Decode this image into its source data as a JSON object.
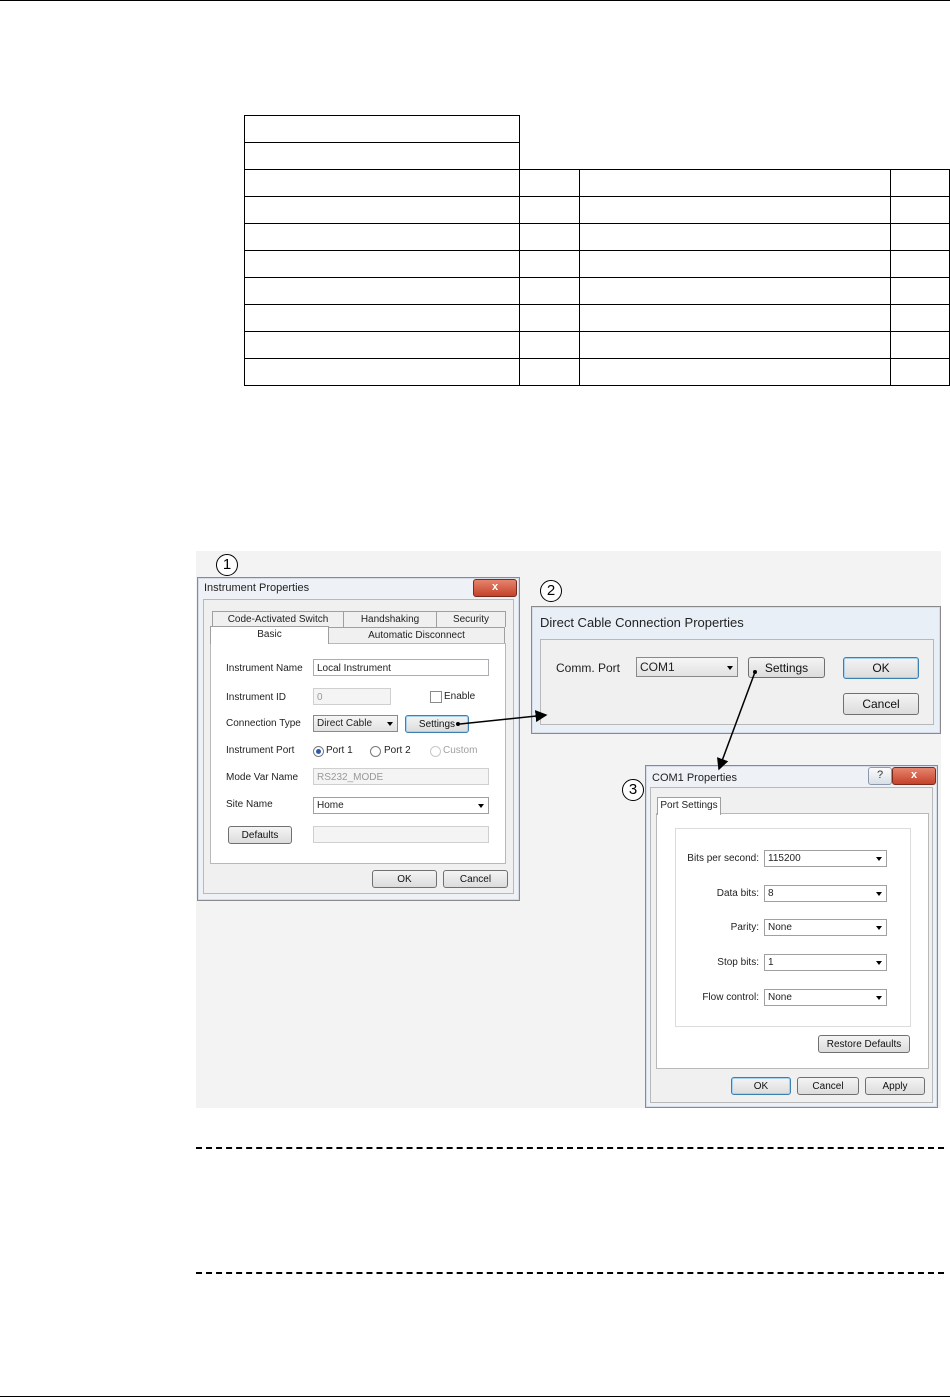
{
  "figure": {
    "callouts": [
      "1",
      "2",
      "3"
    ],
    "instrument_properties": {
      "title": "Instrument Properties",
      "close": "x",
      "tabs_back": [
        "Code-Activated Switch",
        "Handshaking",
        "Security"
      ],
      "tabs_front": [
        "Basic",
        "Automatic Disconnect"
      ],
      "instrument_name_label": "Instrument Name",
      "instrument_name_value": "Local Instrument",
      "instrument_id_label": "Instrument ID",
      "instrument_id_value": "0",
      "enable_label": "Enable",
      "connection_type_label": "Connection Type",
      "connection_type_value": "Direct Cable",
      "settings_button": "Settings",
      "instrument_port_label": "Instrument Port",
      "port1": "Port 1",
      "port2": "Port 2",
      "custom": "Custom",
      "mode_var_label": "Mode Var Name",
      "mode_var_value": "RS232_MODE",
      "site_name_label": "Site Name",
      "site_name_value": "Home",
      "defaults_button": "Defaults",
      "ok": "OK",
      "cancel": "Cancel"
    },
    "direct_cable": {
      "title": "Direct Cable Connection Properties",
      "comm_port_label": "Comm. Port",
      "comm_port_value": "COM1",
      "settings_button": "Settings",
      "ok": "OK",
      "cancel": "Cancel"
    },
    "com1": {
      "title": "COM1 Properties",
      "help": "?",
      "close": "x",
      "tab": "Port Settings",
      "bits_label": "Bits per second:",
      "bits_value": "115200",
      "data_bits_label": "Data bits:",
      "data_bits_value": "8",
      "parity_label": "Parity:",
      "parity_value": "None",
      "stop_bits_label": "Stop bits:",
      "stop_bits_value": "1",
      "flow_label": "Flow control:",
      "flow_value": "None",
      "restore_button": "Restore Defaults",
      "ok": "OK",
      "cancel": "Cancel",
      "apply": "Apply"
    }
  }
}
